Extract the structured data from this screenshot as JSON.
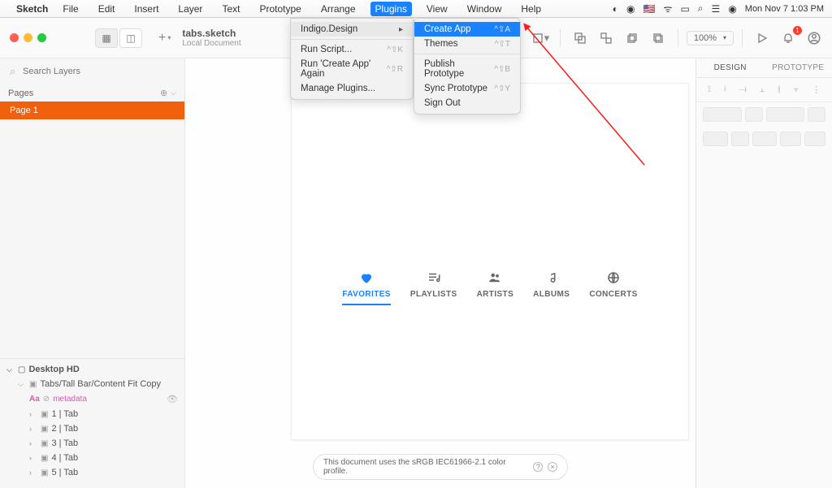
{
  "menubar": {
    "app": "Sketch",
    "items": [
      "File",
      "Edit",
      "Insert",
      "Layer",
      "Text",
      "Prototype",
      "Arrange",
      "Plugins",
      "View",
      "Window",
      "Help"
    ],
    "active": "Plugins",
    "datetime": "Mon Nov 7  1:03 PM"
  },
  "doc": {
    "title": "tabs.sketch",
    "subtitle": "Local Document"
  },
  "zoom": "100%",
  "notif_badge": "1",
  "sidebar": {
    "search_placeholder": "Search Layers",
    "pages_label": "Pages",
    "page1": "Page 1",
    "desktop": "Desktop HD",
    "artboard": "Tabs/Tall Bar/Content Fit Copy",
    "meta_label": "metadata",
    "layers": [
      "1 | Tab",
      "2 | Tab",
      "3 | Tab",
      "4 | Tab",
      "5 | Tab"
    ]
  },
  "tabs": [
    "FAVORITES",
    "PLAYLISTS",
    "ARTISTS",
    "ALBUMS",
    "CONCERTS"
  ],
  "right": {
    "design": "DESIGN",
    "prototype": "PROTOTYPE"
  },
  "footer": "This document uses the sRGB IEC61966-2.1 color profile.",
  "dropdown": {
    "indigo": "Indigo.Design",
    "run_script": "Run Script...",
    "run_again": "Run 'Create App' Again",
    "manage": "Manage Plugins...",
    "sc_run": "^⇧K",
    "sc_again": "^⇧R"
  },
  "submenu": {
    "create": "Create App",
    "themes": "Themes",
    "publish": "Publish Prototype",
    "sync": "Sync Prototype",
    "signout": "Sign Out",
    "sc_create": "^⇧A",
    "sc_themes": "^⇧T",
    "sc_publish": "^⇧B",
    "sc_sync": "^⇧Y"
  }
}
